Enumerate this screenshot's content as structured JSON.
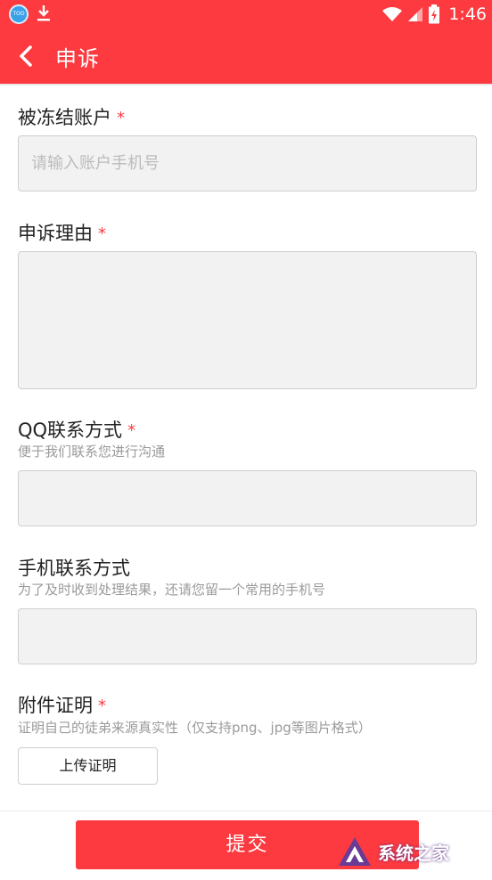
{
  "status_bar": {
    "time": "1:46",
    "app_icon_text": "TOO"
  },
  "header": {
    "title": "申诉"
  },
  "form": {
    "account": {
      "label": "被冻结账户",
      "required": "*",
      "placeholder": "请输入账户手机号"
    },
    "reason": {
      "label": "申诉理由",
      "required": "*"
    },
    "qq": {
      "label": "QQ联系方式",
      "required": "*",
      "hint": "便于我们联系您进行沟通"
    },
    "phone": {
      "label": "手机联系方式",
      "hint": "为了及时收到处理结果，还请您留一个常用的手机号"
    },
    "attachment": {
      "label": "附件证明",
      "required": "*",
      "hint": "证明自己的徒弟来源真实性（仅支持png、jpg等图片格式）",
      "upload_label": "上传证明"
    }
  },
  "footer": {
    "submit_label": "提交"
  },
  "watermark": {
    "text": "系统之家"
  },
  "colors": {
    "accent": "#fc3a3f",
    "field_bg": "#f2f2f2",
    "hint": "#9a9a9a"
  }
}
